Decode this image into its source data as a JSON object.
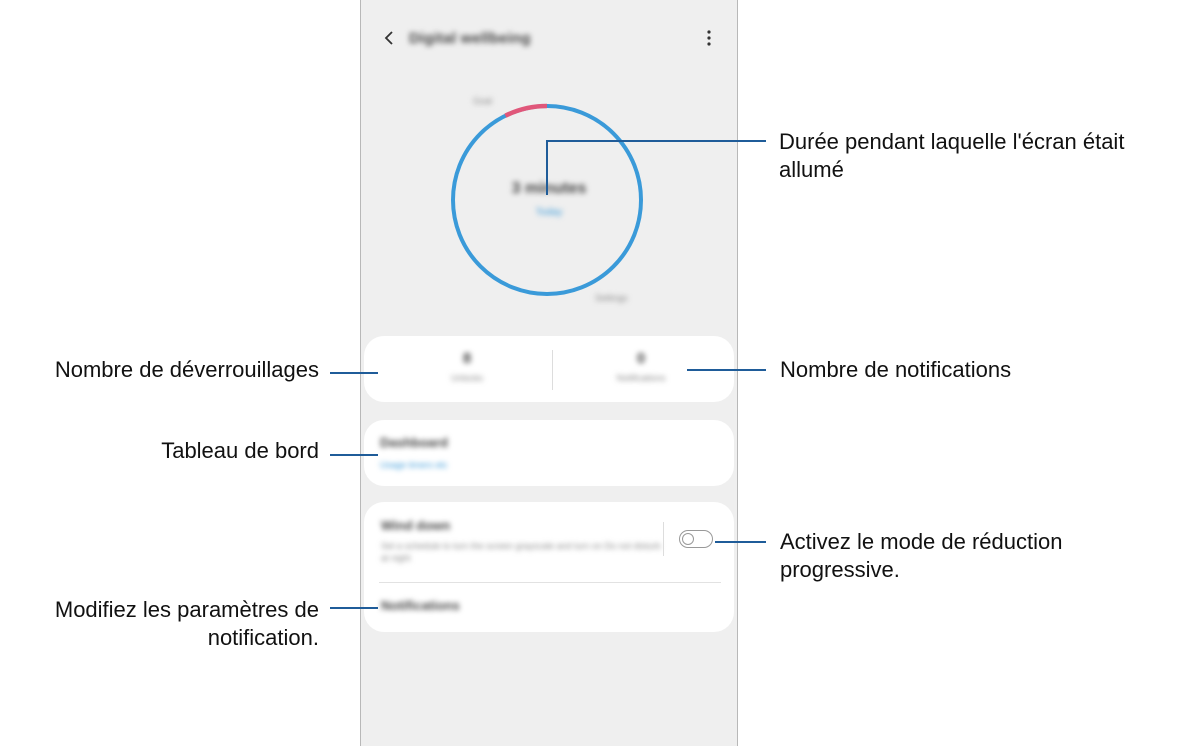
{
  "app": {
    "title": "Digital wellbeing"
  },
  "ring": {
    "top_label": "Goal",
    "value_text": "3 minutes",
    "sub_text": "Today",
    "bottom_label": "Settings",
    "accent_color": "#3a9ad9",
    "goal_color": "#e0577a"
  },
  "stats": [
    {
      "number": "8",
      "label": "Unlocks"
    },
    {
      "number": "0",
      "label": "Notifications"
    }
  ],
  "dashboard": {
    "title": "Dashboard",
    "link": "Usage timers etc"
  },
  "wind_down": {
    "title": "Wind down",
    "description": "Set a schedule to turn the screen grayscale and turn on Do not disturb at night",
    "toggle_on": false
  },
  "notifications_item": {
    "title": "Notifications"
  },
  "annotations": {
    "screen_time_line1": "Durée pendant laquelle l'écran était",
    "screen_time_line2": "allumé",
    "unlocks": "Nombre de déverrouillages",
    "notifications": "Nombre de notifications",
    "dashboard": "Tableau de bord",
    "wind_down_line1": "Activez le mode de réduction",
    "wind_down_line2": "progressive.",
    "notif_settings_line1": "Modifiez les paramètres de",
    "notif_settings_line2": "notification."
  }
}
